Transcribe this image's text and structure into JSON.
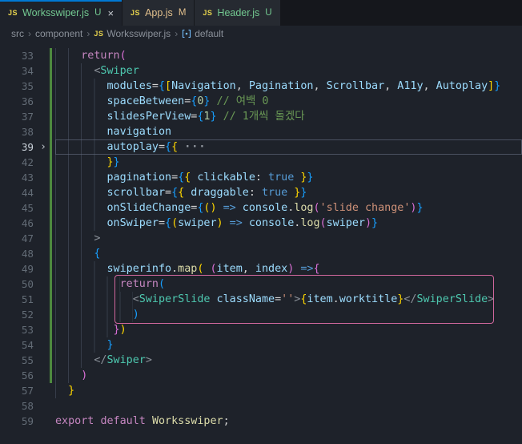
{
  "icons": {
    "js_label": "JS"
  },
  "colors": {
    "accent_blue": "#0078d4",
    "git_untracked_green": "#73C991",
    "git_modified_yellow": "#E2C08D",
    "git_added_gutter_green": "#4e8a3f",
    "highlight_box_pink": "#d0679d",
    "js_icon_yellow": "#e8d44d"
  },
  "tabs": [
    {
      "name": "Worksswiper.js",
      "badge": "U",
      "state": "untracked",
      "active": true,
      "close": "×"
    },
    {
      "name": "App.js",
      "badge": "M",
      "state": "modified",
      "active": false
    },
    {
      "name": "Header.js",
      "badge": "U",
      "state": "untracked",
      "active": false
    }
  ],
  "breadcrumbs": {
    "separator": "›",
    "items": [
      "src",
      "component",
      "Worksswiper.js",
      "default"
    ]
  },
  "editor": {
    "lines": [
      {
        "n": 33,
        "git": true,
        "indent": 4,
        "current": false,
        "fold": false,
        "tokens": [
          [
            "kw",
            "return"
          ],
          [
            "b2",
            "("
          ]
        ]
      },
      {
        "n": 34,
        "git": true,
        "indent": 6,
        "current": false,
        "fold": false,
        "tokens": [
          [
            "angle",
            "<"
          ],
          [
            "tag",
            "Swiper"
          ]
        ]
      },
      {
        "n": 35,
        "git": true,
        "indent": 8,
        "current": false,
        "fold": false,
        "tokens": [
          [
            "attr",
            "modules"
          ],
          [
            "plain",
            "="
          ],
          [
            "b3",
            "{"
          ],
          [
            "b1",
            "["
          ],
          [
            "attr",
            "Navigation"
          ],
          [
            "plain",
            ", "
          ],
          [
            "attr",
            "Pagination"
          ],
          [
            "plain",
            ", "
          ],
          [
            "attr",
            "Scrollbar"
          ],
          [
            "plain",
            ", "
          ],
          [
            "attr",
            "A11y"
          ],
          [
            "plain",
            ", "
          ],
          [
            "attr",
            "Autoplay"
          ],
          [
            "b1",
            "]"
          ],
          [
            "b3",
            "}"
          ]
        ]
      },
      {
        "n": 36,
        "git": true,
        "indent": 8,
        "current": false,
        "fold": false,
        "tokens": [
          [
            "attr",
            "spaceBetween"
          ],
          [
            "plain",
            "="
          ],
          [
            "b3",
            "{"
          ],
          [
            "num",
            "0"
          ],
          [
            "b3",
            "}"
          ],
          [
            "plain",
            " "
          ],
          [
            "cmt",
            "// 여백 0"
          ]
        ]
      },
      {
        "n": 37,
        "git": true,
        "indent": 8,
        "current": false,
        "fold": false,
        "tokens": [
          [
            "attr",
            "slidesPerView"
          ],
          [
            "plain",
            "="
          ],
          [
            "b3",
            "{"
          ],
          [
            "num",
            "1"
          ],
          [
            "b3",
            "}"
          ],
          [
            "plain",
            " "
          ],
          [
            "cmt",
            "// 1개씩 돌겠다"
          ]
        ]
      },
      {
        "n": 38,
        "git": true,
        "indent": 8,
        "current": false,
        "fold": false,
        "tokens": [
          [
            "attr",
            "navigation"
          ]
        ]
      },
      {
        "n": 39,
        "git": true,
        "indent": 8,
        "current": true,
        "fold": true,
        "tokens": [
          [
            "attr",
            "autoplay"
          ],
          [
            "plain",
            "="
          ],
          [
            "b3",
            "{"
          ],
          [
            "b1",
            "{"
          ],
          [
            "plain",
            " "
          ],
          [
            "fold",
            "···"
          ]
        ]
      },
      {
        "n": 42,
        "git": true,
        "indent": 8,
        "current": false,
        "fold": false,
        "tokens": [
          [
            "b1",
            "}"
          ],
          [
            "b3",
            "}"
          ]
        ]
      },
      {
        "n": 43,
        "git": true,
        "indent": 8,
        "current": false,
        "fold": false,
        "tokens": [
          [
            "attr",
            "pagination"
          ],
          [
            "plain",
            "="
          ],
          [
            "b3",
            "{"
          ],
          [
            "b1",
            "{"
          ],
          [
            "plain",
            " "
          ],
          [
            "attr",
            "clickable"
          ],
          [
            "plain",
            ": "
          ],
          [
            "kwb",
            "true"
          ],
          [
            "plain",
            " "
          ],
          [
            "b1",
            "}"
          ],
          [
            "b3",
            "}"
          ]
        ]
      },
      {
        "n": 44,
        "git": true,
        "indent": 8,
        "current": false,
        "fold": false,
        "tokens": [
          [
            "attr",
            "scrollbar"
          ],
          [
            "plain",
            "="
          ],
          [
            "b3",
            "{"
          ],
          [
            "b1",
            "{"
          ],
          [
            "plain",
            " "
          ],
          [
            "attr",
            "draggable"
          ],
          [
            "plain",
            ": "
          ],
          [
            "kwb",
            "true"
          ],
          [
            "plain",
            " "
          ],
          [
            "b1",
            "}"
          ],
          [
            "b3",
            "}"
          ]
        ]
      },
      {
        "n": 45,
        "git": true,
        "indent": 8,
        "current": false,
        "fold": false,
        "tokens": [
          [
            "attr",
            "onSlideChange"
          ],
          [
            "plain",
            "="
          ],
          [
            "b3",
            "{"
          ],
          [
            "b1",
            "("
          ],
          [
            "b1",
            ")"
          ],
          [
            "plain",
            " "
          ],
          [
            "kwb",
            "=>"
          ],
          [
            "plain",
            " "
          ],
          [
            "attr",
            "console"
          ],
          [
            "plain",
            "."
          ],
          [
            "fn",
            "log"
          ],
          [
            "b2",
            "("
          ],
          [
            "str",
            "'slide change'"
          ],
          [
            "b2",
            ")"
          ],
          [
            "b3",
            "}"
          ]
        ]
      },
      {
        "n": 46,
        "git": true,
        "indent": 8,
        "current": false,
        "fold": false,
        "tokens": [
          [
            "attr",
            "onSwiper"
          ],
          [
            "plain",
            "="
          ],
          [
            "b3",
            "{"
          ],
          [
            "b1",
            "("
          ],
          [
            "attr",
            "swiper"
          ],
          [
            "b1",
            ")"
          ],
          [
            "plain",
            " "
          ],
          [
            "kwb",
            "=>"
          ],
          [
            "plain",
            " "
          ],
          [
            "attr",
            "console"
          ],
          [
            "plain",
            "."
          ],
          [
            "fn",
            "log"
          ],
          [
            "b2",
            "("
          ],
          [
            "attr",
            "swiper"
          ],
          [
            "b2",
            ")"
          ],
          [
            "b3",
            "}"
          ]
        ]
      },
      {
        "n": 47,
        "git": true,
        "indent": 6,
        "current": false,
        "fold": false,
        "tokens": [
          [
            "angle",
            ">"
          ]
        ]
      },
      {
        "n": 48,
        "git": true,
        "indent": 6,
        "current": false,
        "fold": false,
        "tokens": [
          [
            "b3",
            "{"
          ]
        ]
      },
      {
        "n": 49,
        "git": true,
        "indent": 8,
        "current": false,
        "fold": false,
        "tokens": [
          [
            "attr",
            "swiperinfo"
          ],
          [
            "plain",
            "."
          ],
          [
            "fn",
            "map"
          ],
          [
            "b1",
            "("
          ],
          [
            "plain",
            " "
          ],
          [
            "b2",
            "("
          ],
          [
            "attr",
            "item"
          ],
          [
            "plain",
            ", "
          ],
          [
            "attr",
            "index"
          ],
          [
            "b2",
            ")"
          ],
          [
            "plain",
            " "
          ],
          [
            "kwb",
            "=>"
          ],
          [
            "b2",
            "{"
          ]
        ]
      },
      {
        "n": 50,
        "git": true,
        "indent": 10,
        "current": false,
        "fold": false,
        "tokens": [
          [
            "kw",
            "return"
          ],
          [
            "b3",
            "("
          ]
        ]
      },
      {
        "n": 51,
        "git": true,
        "indent": 12,
        "current": false,
        "fold": false,
        "tokens": [
          [
            "angle",
            "<"
          ],
          [
            "tag",
            "SwiperSlide"
          ],
          [
            "plain",
            " "
          ],
          [
            "attr",
            "className"
          ],
          [
            "plain",
            "="
          ],
          [
            "str",
            "''"
          ],
          [
            "angle",
            ">"
          ],
          [
            "b1",
            "{"
          ],
          [
            "attr",
            "item"
          ],
          [
            "plain",
            "."
          ],
          [
            "attr",
            "worktitle"
          ],
          [
            "b1",
            "}"
          ],
          [
            "angle",
            "</"
          ],
          [
            "tag",
            "SwiperSlide"
          ],
          [
            "angle",
            ">"
          ]
        ]
      },
      {
        "n": 52,
        "git": true,
        "indent": 12,
        "current": false,
        "fold": false,
        "tokens": [
          [
            "b3",
            ")"
          ]
        ]
      },
      {
        "n": 53,
        "git": true,
        "indent": 9,
        "current": false,
        "fold": false,
        "tokens": [
          [
            "b2",
            "}"
          ],
          [
            "b1",
            ")"
          ]
        ]
      },
      {
        "n": 54,
        "git": true,
        "indent": 8,
        "current": false,
        "fold": false,
        "tokens": [
          [
            "b3",
            "}"
          ]
        ]
      },
      {
        "n": 55,
        "git": true,
        "indent": 6,
        "current": false,
        "fold": false,
        "tokens": [
          [
            "angle",
            "</"
          ],
          [
            "tag",
            "Swiper"
          ],
          [
            "angle",
            ">"
          ]
        ]
      },
      {
        "n": 56,
        "git": true,
        "indent": 4,
        "current": false,
        "fold": false,
        "tokens": [
          [
            "b2",
            ")"
          ]
        ]
      },
      {
        "n": 57,
        "git": false,
        "indent": 2,
        "current": false,
        "fold": false,
        "tokens": [
          [
            "b1",
            "}"
          ]
        ]
      },
      {
        "n": 58,
        "git": false,
        "indent": 0,
        "current": false,
        "fold": false,
        "tokens": []
      },
      {
        "n": 59,
        "git": false,
        "indent": 0,
        "current": false,
        "fold": false,
        "tokens": [
          [
            "kw",
            "export"
          ],
          [
            "plain",
            " "
          ],
          [
            "kw",
            "default"
          ],
          [
            "plain",
            " "
          ],
          [
            "fn",
            "Worksswiper"
          ],
          [
            "plain",
            ";"
          ]
        ]
      }
    ],
    "highlight_box_lines": [
      50,
      52
    ]
  }
}
